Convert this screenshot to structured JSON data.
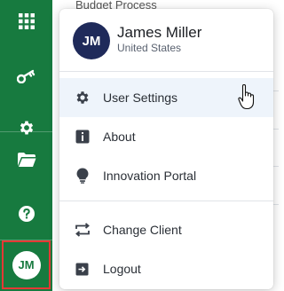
{
  "background": {
    "title": "Budget Process"
  },
  "rail": {
    "items": [
      {
        "name": "apps-grid-icon"
      },
      {
        "name": "key-icon"
      },
      {
        "name": "settings-icon"
      },
      {
        "name": "folder-icon"
      },
      {
        "name": "help-icon"
      }
    ],
    "avatar_initials": "JM"
  },
  "menu": {
    "avatar_initials": "JM",
    "user_name": "James Miller",
    "user_location": "United States",
    "items": [
      {
        "label": "User Settings",
        "icon": "gear-icon",
        "hovered": true
      },
      {
        "label": "About",
        "icon": "info-icon"
      },
      {
        "label": "Innovation Portal",
        "icon": "lightbulb-icon"
      },
      {
        "label": "Change Client",
        "icon": "swap-icon"
      },
      {
        "label": "Logout",
        "icon": "logout-icon"
      }
    ]
  },
  "colors": {
    "rail_green": "#177a3f",
    "avatar_navy": "#1f2a5a",
    "highlight_red": "#e53935",
    "hover_bg": "#eef4fb"
  }
}
